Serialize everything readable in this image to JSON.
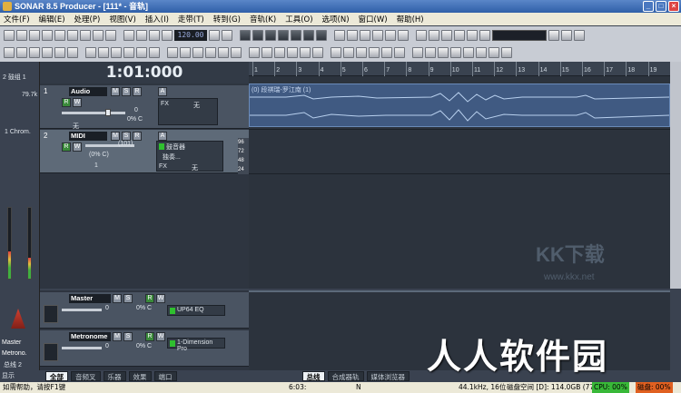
{
  "window": {
    "title": "SONAR 8.5 Producer - [111* - 音轨]"
  },
  "menu": [
    "文件(F)",
    "编辑(E)",
    "处理(P)",
    "视图(V)",
    "插入(I)",
    "走带(T)",
    "转到(G)",
    "音轨(K)",
    "工具(O)",
    "选项(N)",
    "窗口(W)",
    "帮助(H)"
  ],
  "toolbar": {
    "tempo": "120.00"
  },
  "left_strip": {
    "row1": "2 鼓组 1",
    "row2": "1 Chrom.",
    "level": "79.7k",
    "labels": [
      "Master",
      "Metrono.",
      "总线 2",
      "显示"
    ]
  },
  "now_time": "1:01:000",
  "tracks": [
    {
      "num": "1",
      "name": "Audio",
      "vol": "0",
      "pan": "0% C",
      "input": "无",
      "fx": "FX",
      "fx_val": "无"
    },
    {
      "num": "2",
      "name": "MIDI",
      "vol": "(101)",
      "pan": "(0% C)",
      "chan": "1",
      "inst": "鼓音器",
      "patch": "独奏...",
      "fx": "FX",
      "fx_val": "无"
    }
  ],
  "ruler": [
    "1",
    "2",
    "3",
    "4",
    "5",
    "6",
    "7",
    "8",
    "9",
    "10",
    "11",
    "12",
    "13",
    "14",
    "15",
    "16",
    "17",
    "18",
    "19"
  ],
  "clip": {
    "label": "(0) 段祺瑞-罗江南 (1)"
  },
  "piano_keys": [
    "96",
    "72",
    "48",
    "24"
  ],
  "buses": [
    {
      "name": "Master",
      "vol": "0",
      "pan": "0% C",
      "fx": "UP64 EQ"
    },
    {
      "name": "Metronome",
      "vol": "0",
      "pan": "0% C",
      "fx": "1-Dimension Pro"
    }
  ],
  "tabs_left": [
    "全部",
    "音频叉",
    "乐器",
    "效果",
    "端口"
  ],
  "tabs_right": [
    "总线",
    "合成器轨",
    "媒体浏览器"
  ],
  "status": {
    "help": "如需帮助，请按F1键",
    "time": "6:03:",
    "mode": "N",
    "rate": "44.1kHz, 16位",
    "disk": "磁盘空间 [D]: 114.0GB (77%",
    "cpu": "CPU: 00%",
    "disk_io": "磁盘: 00%"
  },
  "watermark": {
    "big": "人人软件园",
    "logo": "KK下载",
    "url": "www.kkx.net"
  }
}
